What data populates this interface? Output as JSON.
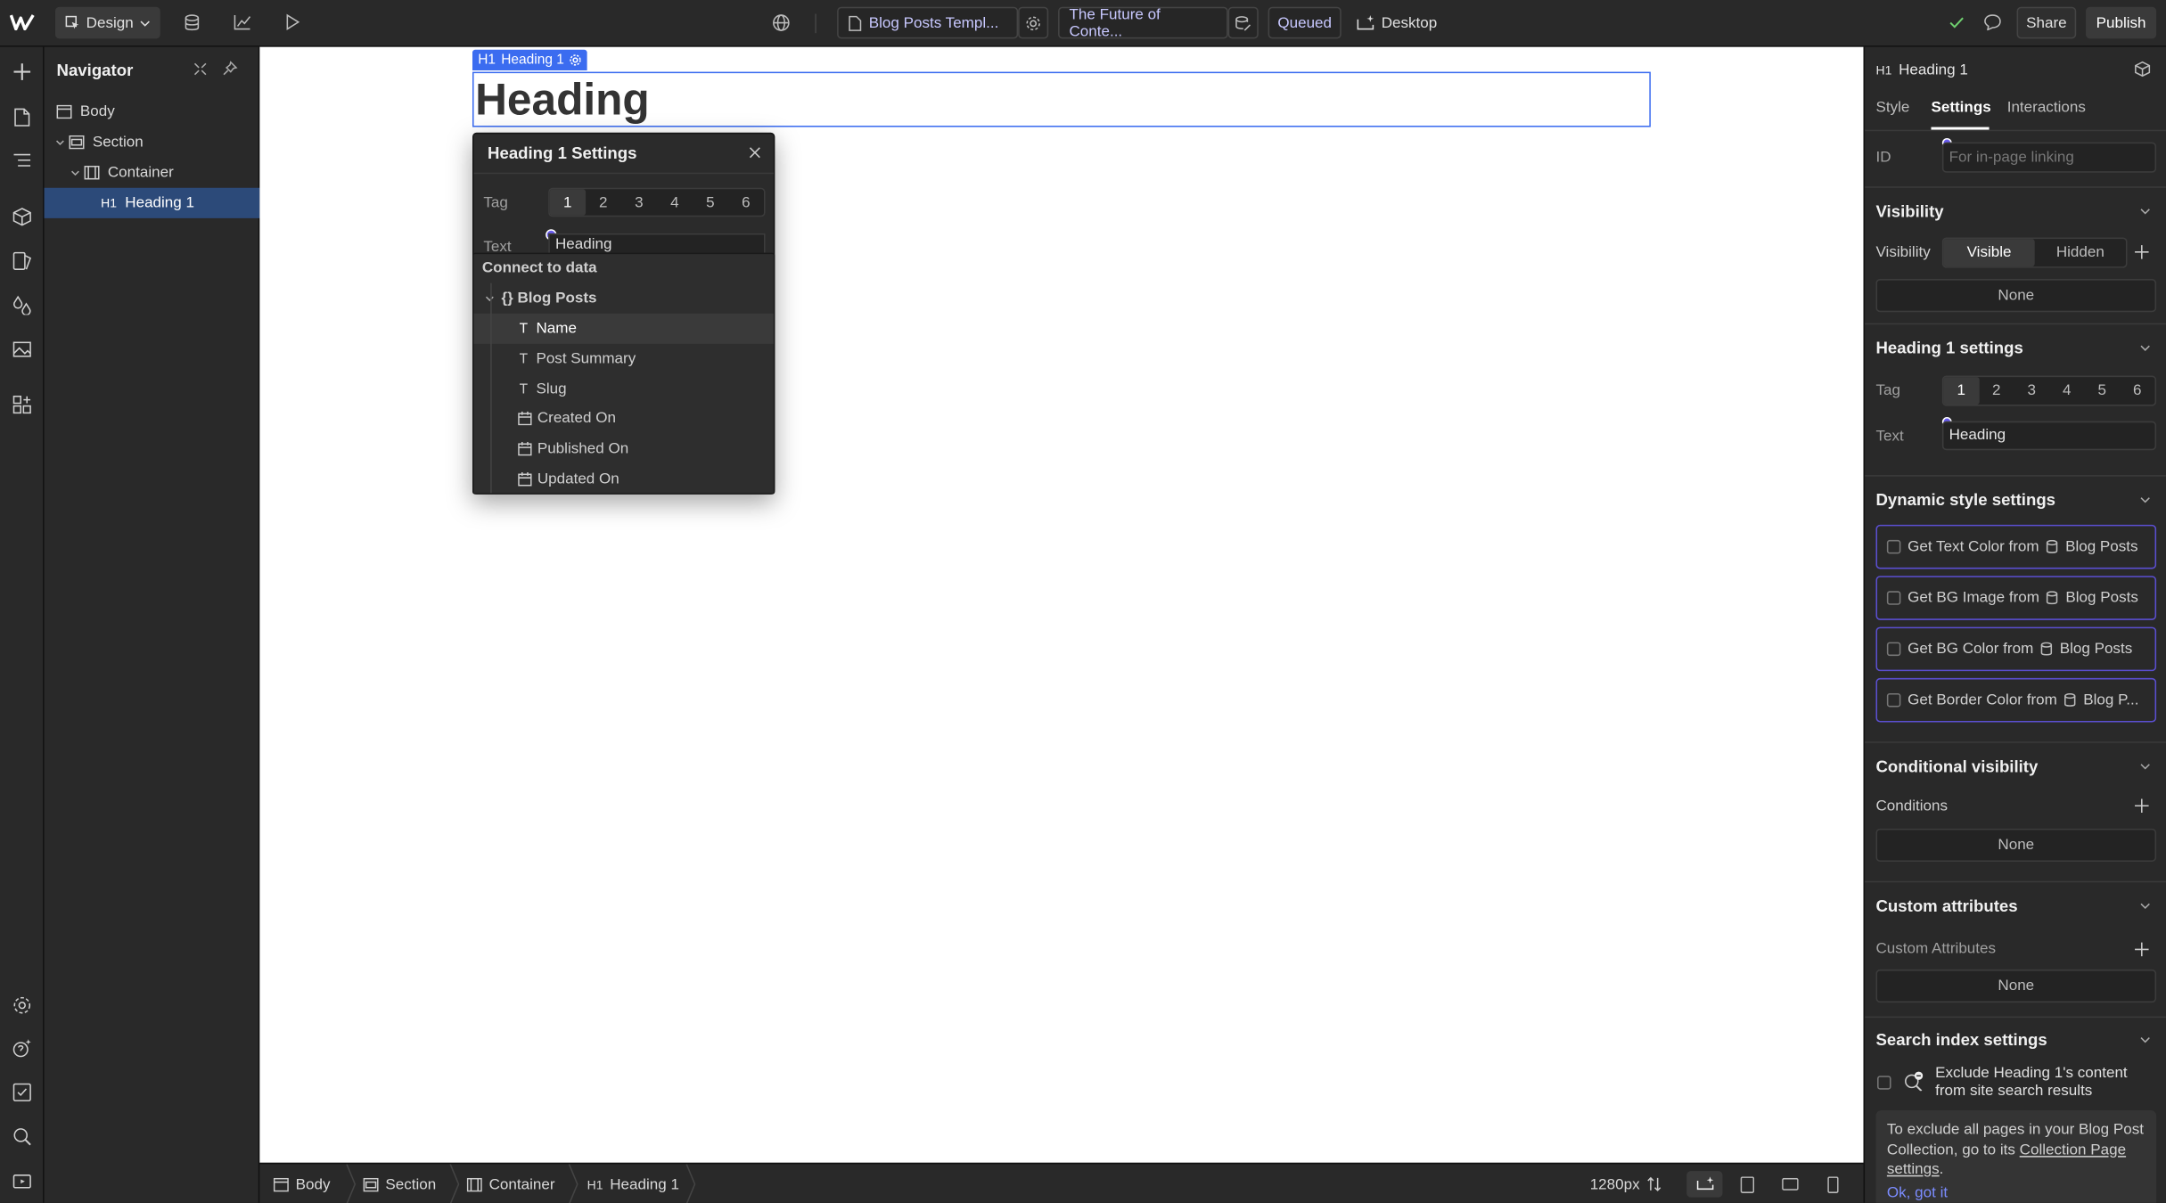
{
  "colors": {
    "accent": "#4c7ff0",
    "purple": "#6a5cf0",
    "canvas": "#ffffff",
    "panel": "#292929"
  },
  "topbar": {
    "mode_label": "Design",
    "page_label": "Blog Posts Templ...",
    "item_label": "The Future of Conte...",
    "status_label": "Queued",
    "breakpoint_label": "Desktop",
    "share_label": "Share",
    "publish_label": "Publish"
  },
  "navigator": {
    "title": "Navigator",
    "items": [
      {
        "label": "Body"
      },
      {
        "label": "Section"
      },
      {
        "label": "Container"
      },
      {
        "tag": "H1",
        "label": "Heading 1"
      }
    ]
  },
  "canvas": {
    "selection_tag": "H1",
    "selection_label": "Heading 1",
    "heading_text": "Heading"
  },
  "popup": {
    "title": "Heading 1 Settings",
    "tag_label": "Tag",
    "tags": [
      "1",
      "2",
      "3",
      "4",
      "5",
      "6"
    ],
    "text_label": "Text",
    "text_value": "Heading",
    "connect_title": "Connect to data",
    "collection": "Blog Posts",
    "fields": [
      {
        "type": "T",
        "label": "Name"
      },
      {
        "type": "T",
        "label": "Post Summary"
      },
      {
        "type": "T",
        "label": "Slug"
      },
      {
        "type": "date",
        "label": "Created On"
      },
      {
        "type": "date",
        "label": "Published On"
      },
      {
        "type": "date",
        "label": "Updated On"
      }
    ]
  },
  "bottombar": {
    "crumbs": [
      {
        "label": "Body"
      },
      {
        "label": "Section"
      },
      {
        "label": "Container"
      },
      {
        "tag": "H1",
        "label": "Heading 1"
      }
    ],
    "width_label": "1280px"
  },
  "rpanel": {
    "element_tag": "H1",
    "element_label": "Heading 1",
    "tabs": [
      "Style",
      "Settings",
      "Interactions"
    ],
    "id_label": "ID",
    "id_placeholder": "For in-page linking",
    "visibility_title": "Visibility",
    "visibility_label": "Visibility",
    "visible_label": "Visible",
    "hidden_label": "Hidden",
    "visibility_none": "None",
    "heading_settings_title": "Heading 1 settings",
    "tag_label": "Tag",
    "tags": [
      "1",
      "2",
      "3",
      "4",
      "5",
      "6"
    ],
    "text_label": "Text",
    "text_value": "Heading",
    "dynamic_title": "Dynamic style settings",
    "dynamic": [
      {
        "label": "Get Text Color from",
        "source": "Blog Posts"
      },
      {
        "label": "Get BG Image from",
        "source": "Blog Posts"
      },
      {
        "label": "Get BG Color from",
        "source": "Blog Posts"
      },
      {
        "label": "Get Border Color from",
        "source": "Blog P..."
      }
    ],
    "cond_title": "Conditional visibility",
    "cond_label": "Conditions",
    "cond_none": "None",
    "attrs_title": "Custom attributes",
    "attrs_label": "Custom Attributes",
    "attrs_none": "None",
    "search_title": "Search index settings",
    "search_text": "Exclude Heading 1's content from site search results",
    "note_prefix": "To exclude all pages in your Blog Post Collection, go to its ",
    "note_link": "Collection Page settings",
    "note_suffix": ".",
    "ok_label": "Ok, got it"
  }
}
